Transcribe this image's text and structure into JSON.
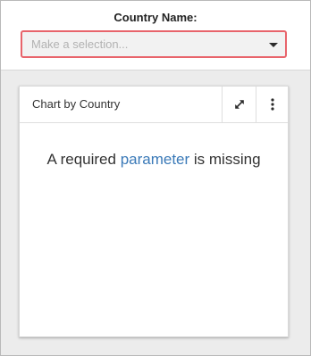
{
  "parameter": {
    "label": "Country Name:",
    "placeholder": "Make a selection..."
  },
  "card": {
    "title": "Chart by Country",
    "icons": {
      "expand": "expand-icon",
      "more": "more-vertical-icon"
    },
    "message": {
      "before": "A required ",
      "link": "parameter",
      "after": " is missing"
    }
  },
  "colors": {
    "select_border": "#e8646b",
    "link": "#3b7ab8",
    "background": "#ececec"
  }
}
